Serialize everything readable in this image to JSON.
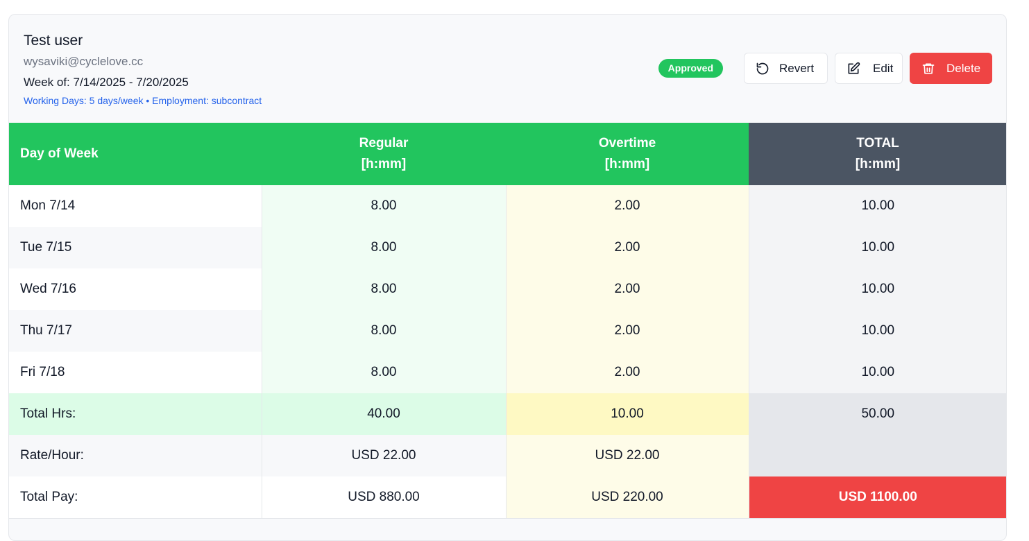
{
  "user": {
    "name": "Test user",
    "email": "wysaviki@cyclelove.cc",
    "week": "Week of: 7/14/2025 - 7/20/2025",
    "meta": "Working Days: 5 days/week • Employment: subcontract"
  },
  "status": {
    "label": "Approved",
    "color": "#22c55e"
  },
  "actions": {
    "revert_label": "Revert",
    "edit_label": "Edit",
    "delete_label": "Delete"
  },
  "table": {
    "headers": {
      "day": "Day of Week",
      "regular": "Regular",
      "regular_unit": "[h:mm]",
      "overtime": "Overtime",
      "overtime_unit": "[h:mm]",
      "total": "TOTAL",
      "total_unit": "[h:mm]"
    },
    "rows": [
      {
        "day": "Mon 7/14",
        "regular": "8.00",
        "overtime": "2.00",
        "total": "10.00"
      },
      {
        "day": "Tue 7/15",
        "regular": "8.00",
        "overtime": "2.00",
        "total": "10.00"
      },
      {
        "day": "Wed 7/16",
        "regular": "8.00",
        "overtime": "2.00",
        "total": "10.00"
      },
      {
        "day": "Thu 7/17",
        "regular": "8.00",
        "overtime": "2.00",
        "total": "10.00"
      },
      {
        "day": "Fri 7/18",
        "regular": "8.00",
        "overtime": "2.00",
        "total": "10.00"
      }
    ],
    "total_hrs": {
      "label": "Total Hrs:",
      "regular": "40.00",
      "overtime": "10.00",
      "total": "50.00"
    },
    "rate": {
      "label": "Rate/Hour:",
      "regular": "USD 22.00",
      "overtime": "USD 22.00",
      "total": ""
    },
    "pay": {
      "label": "Total Pay:",
      "regular": "USD 880.00",
      "overtime": "USD 220.00",
      "total": "USD 1100.00"
    }
  },
  "colors": {
    "accent_green": "#22c55e",
    "header_gray": "#4b5563",
    "danger_red": "#ef4444",
    "link_blue": "#2563eb"
  }
}
